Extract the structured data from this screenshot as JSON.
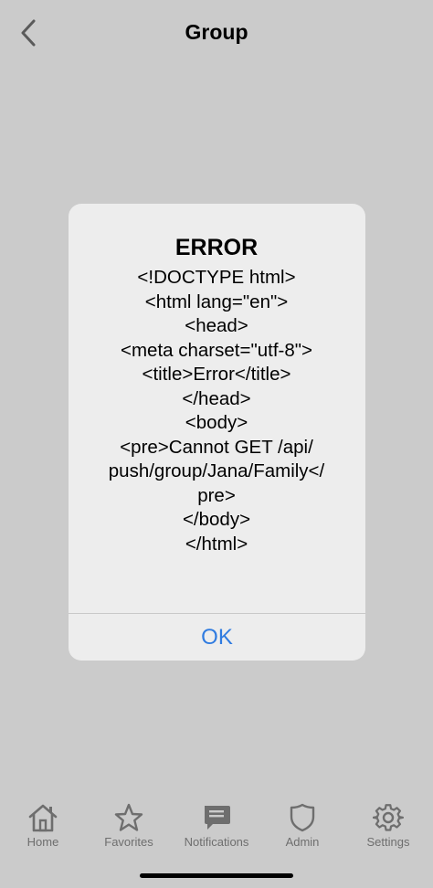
{
  "header": {
    "title": "Group"
  },
  "alert": {
    "title": "ERROR",
    "message_lines": [
      "<!DOCTYPE html>",
      "<html lang=\"en\">",
      "<head>",
      "<meta charset=\"utf-8\">",
      "<title>Error</title>",
      "</head>",
      "<body>",
      "<pre>Cannot GET /api/",
      "push/group/Jana/Family</",
      "pre>",
      "</body>",
      "</html>"
    ],
    "ok_label": "OK"
  },
  "tabbar": {
    "items": [
      {
        "label": "Home",
        "icon": "home-icon"
      },
      {
        "label": "Favorites",
        "icon": "star-icon"
      },
      {
        "label": "Notifications",
        "icon": "chat-icon"
      },
      {
        "label": "Admin",
        "icon": "shield-icon"
      },
      {
        "label": "Settings",
        "icon": "gear-icon"
      }
    ]
  },
  "colors": {
    "background": "#cbcbcb",
    "alert_bg": "#ededed",
    "accent": "#2f7be0",
    "tab_inactive": "#6e6e6e"
  }
}
